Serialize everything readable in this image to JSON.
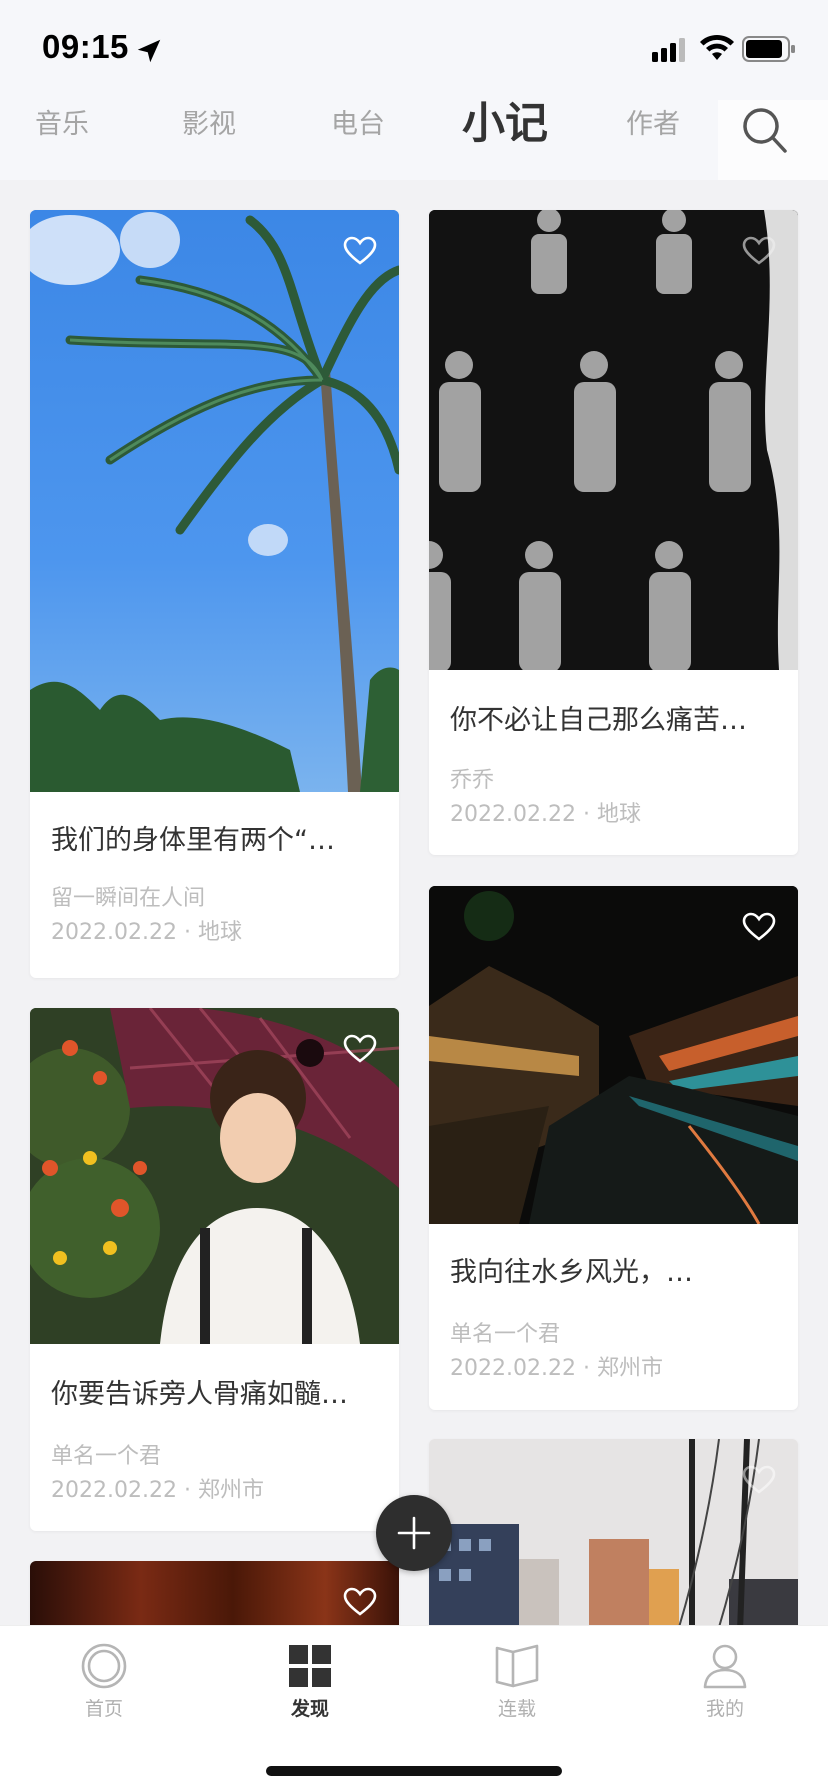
{
  "status_bar": {
    "time": "09:15"
  },
  "top_nav": {
    "tabs": [
      "音乐",
      "影视",
      "电台",
      "小记",
      "作者"
    ],
    "active_tab": "小记"
  },
  "feed": {
    "cards": [
      {
        "title": "我们的身体里有两个“…",
        "author": "留一瞬间在人间",
        "meta": "2022.02.22 · 地球",
        "image": "palm-tree-photo"
      },
      {
        "title": "你不必让自己那么痛苦…",
        "author": "乔乔",
        "meta": "2022.02.22 · 地球",
        "image": "repeated-man-photo"
      },
      {
        "title": "我向往水乡风光，…",
        "author": "单名一个君",
        "meta": "2022.02.22 · 郑州市",
        "image": "water-town-night-photo"
      },
      {
        "title": "你要告诉旁人骨痛如髓…",
        "author": "单名一个君",
        "meta": "2022.02.22 · 郑州市",
        "image": "child-umbrella-photo"
      }
    ]
  },
  "bottom_nav": {
    "items": [
      {
        "label": "首页",
        "icon": "home-circle-icon"
      },
      {
        "label": "发现",
        "icon": "grid-icon"
      },
      {
        "label": "连载",
        "icon": "book-icon"
      },
      {
        "label": "我的",
        "icon": "user-icon"
      }
    ],
    "active": "发现"
  },
  "colors": {
    "accent": "#333333",
    "muted": "#bdbdbd",
    "fab": "#2e2e2e"
  }
}
